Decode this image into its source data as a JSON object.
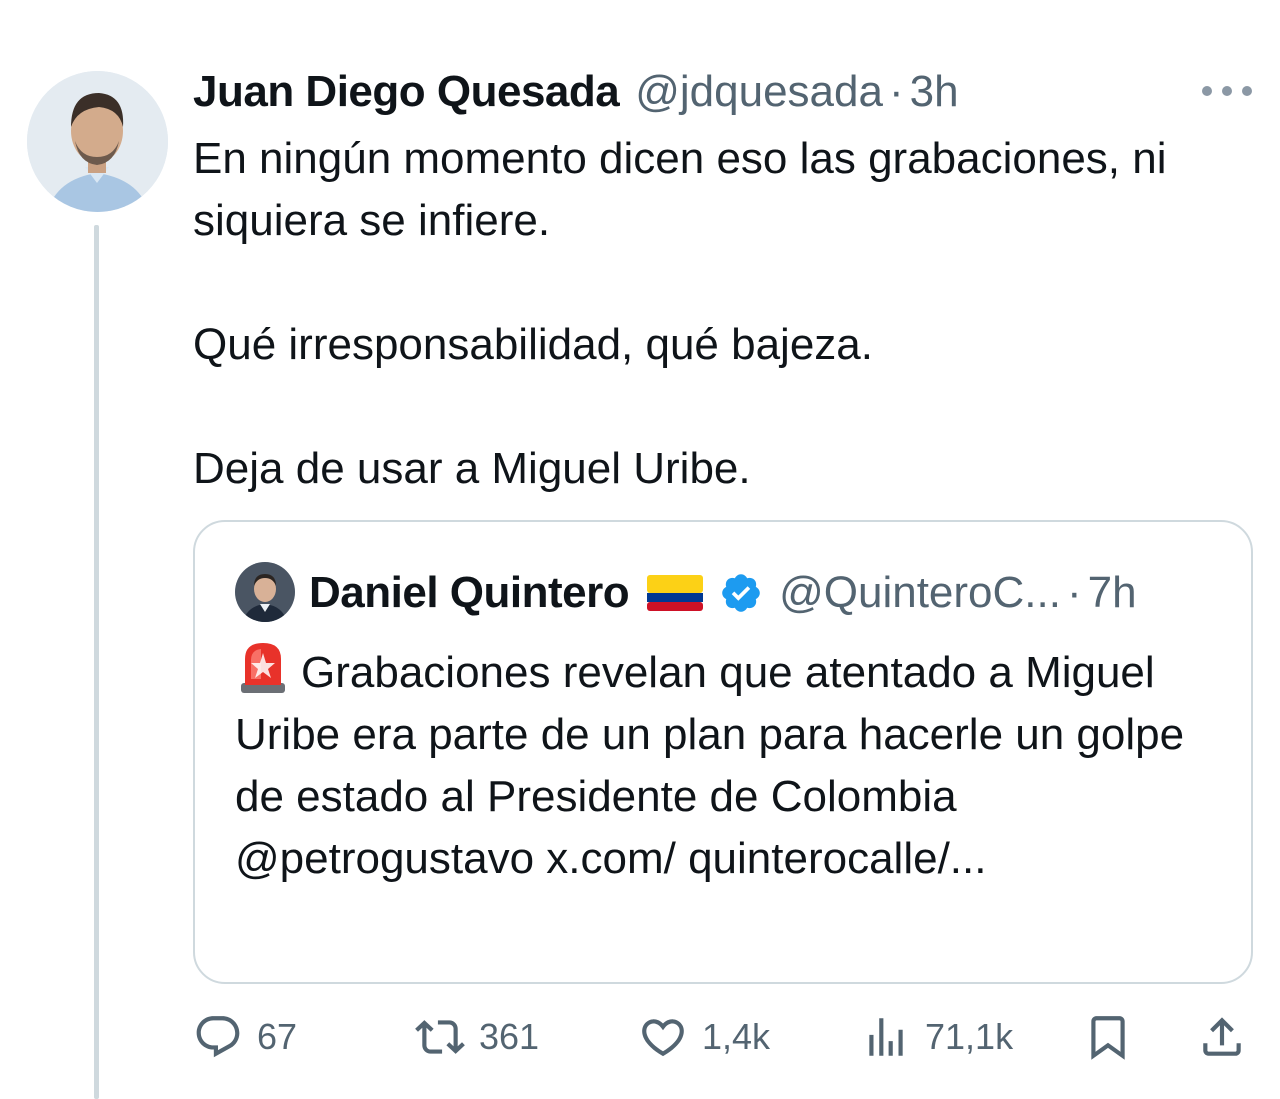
{
  "tweet": {
    "author": {
      "name": "Juan Diego Quesada",
      "handle": "@jdquesada",
      "separator": "·",
      "time": "3h"
    },
    "paragraphs": [
      "En ningún momento dicen eso las grabaciones, ni siquiera se infiere.",
      "Qué irresponsabilidad, qué bajeza.",
      "Deja de usar a Miguel Uribe."
    ],
    "more_icon": "more-horizontal-icon"
  },
  "quote": {
    "author": {
      "name": "Daniel Quintero",
      "handle": "@QuinteroC...",
      "separator": "·",
      "time": "7h",
      "flag_icon": "colombia-flag-icon",
      "verified_icon": "verified-badge-icon"
    },
    "siren_icon": "police-siren-emoji",
    "text": "Grabaciones revelan que atentado a Miguel Uribe era parte de un plan para hacerle un golpe de estado al Presidente de Colombia @petrogustavo x.com/ quinterocalle/..."
  },
  "actions": {
    "replies": "67",
    "retweets": "361",
    "likes": "1,4k",
    "views": "71,1k"
  },
  "colors": {
    "text": "#0f1419",
    "secondary": "#536471",
    "border": "#cfd9de",
    "verified": "#1d9bf0"
  }
}
